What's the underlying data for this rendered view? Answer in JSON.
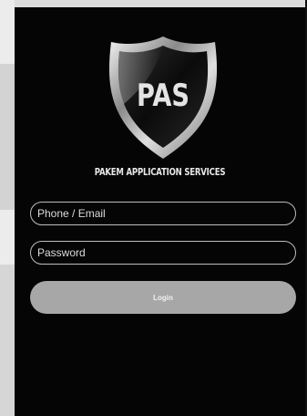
{
  "logo": {
    "text": "PAS",
    "icon": "shield-logo"
  },
  "brand": {
    "name": "PAKEM APPLICATION SERVICES"
  },
  "form": {
    "phone_placeholder": "Phone / Email",
    "password_placeholder": "Password",
    "login_label": "Login"
  },
  "colors": {
    "background": "#050505",
    "field_border": "#bdbdbd",
    "button": "#a7a7a7"
  }
}
